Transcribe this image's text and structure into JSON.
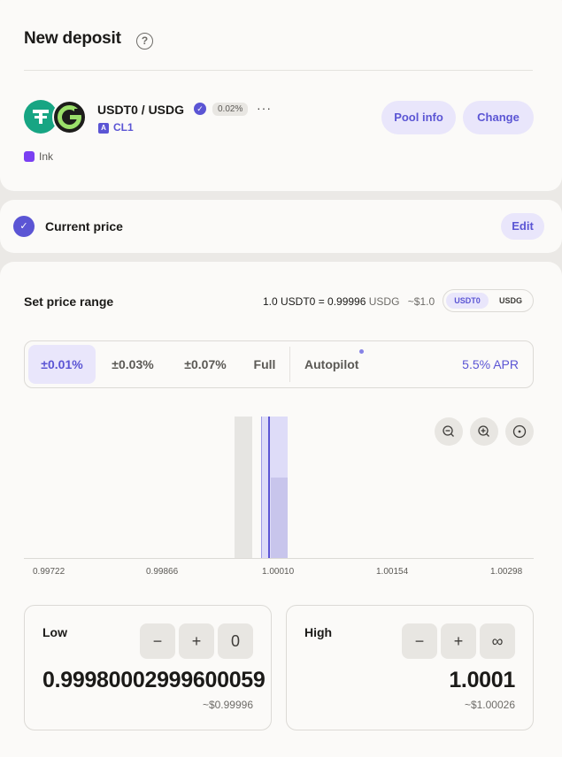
{
  "header": {
    "title": "New deposit"
  },
  "pool": {
    "pair": "USDT0 / USDG",
    "fee": "0.02%",
    "more": "···",
    "type_badge": "A",
    "type": "CL1",
    "chain": "Ink",
    "pool_info_label": "Pool info",
    "change_label": "Change"
  },
  "current_price": {
    "label": "Current price",
    "edit_label": "Edit"
  },
  "price_range": {
    "label": "Set price range",
    "rate_a": "1.0 USDT0 = 0.99996",
    "rate_unit": "USDG",
    "rate_usd": "~$1.0",
    "toggle": [
      "USDT0",
      "USDG"
    ],
    "presets": [
      "±0.01%",
      "±0.03%",
      "±0.07%",
      "Full"
    ],
    "autopilot": "Autopilot",
    "apr": "5.5% APR"
  },
  "chart": {
    "ticks": [
      "0.99722",
      "0.99866",
      "1.00010",
      "1.00154",
      "1.00298"
    ],
    "current_price": 1.0001
  },
  "low": {
    "label": "Low",
    "minus": "−",
    "plus": "+",
    "zero": "0",
    "value": "0.99980002999600059",
    "usd": "~$0.99996"
  },
  "high": {
    "label": "High",
    "minus": "−",
    "plus": "+",
    "infinity": "∞",
    "value": "1.0001",
    "usd": "~$1.00026"
  },
  "colors": {
    "accent": "#5b55d4",
    "accent_soft": "#e9e6fb",
    "tether": "#17a583"
  }
}
